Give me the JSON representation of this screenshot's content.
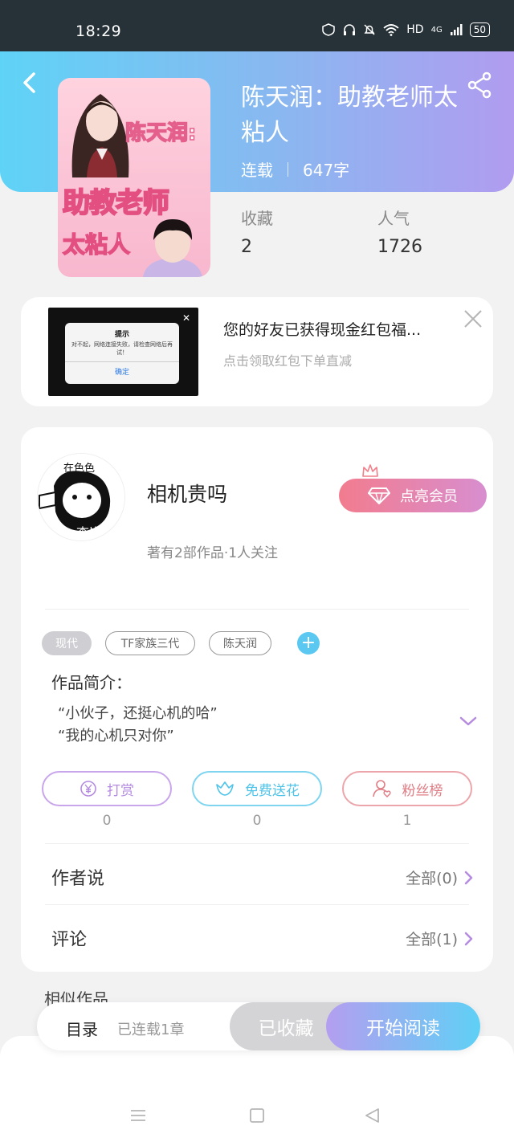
{
  "status_bar": {
    "time": "18:29",
    "network": "HD",
    "signal": "4G",
    "battery": "50"
  },
  "book": {
    "cover_text_1": "陈天润:",
    "cover_text_2": "助教老师",
    "cover_text_3": "太粘人",
    "title": "陈天润：助教老师太粘人",
    "status": "连载",
    "word_count": "647字",
    "stats": [
      {
        "label": "收藏",
        "value": "2"
      },
      {
        "label": "人气",
        "value": "1726"
      }
    ]
  },
  "ad": {
    "dialog_title": "提示",
    "dialog_message": "对不起，网络连接失败，请检查网络后再试！",
    "dialog_ok": "确定",
    "title": "您的好友已获得现金红包福...",
    "subtitle": "点击领取红包下单直减"
  },
  "author": {
    "avatar_text_top": "在色色",
    "avatar_text_bottom": "查岗",
    "name": "相机贵吗",
    "info": "著有2部作品·1人关注",
    "vip_label": "点亮会员"
  },
  "tags": [
    "现代",
    "TF家族三代",
    "陈天润"
  ],
  "intro": {
    "label": "作品简介：",
    "lines": [
      "“小伙子，还挺心机的哈”",
      "“我的心机只对你”"
    ]
  },
  "actions": [
    {
      "label": "打赏",
      "count": "0",
      "icon": "yen-coin-icon",
      "color": "#b58be0"
    },
    {
      "label": "免费送花",
      "count": "0",
      "icon": "flower-icon",
      "color": "#4fc3e8"
    },
    {
      "label": "粉丝榜",
      "count": "1",
      "icon": "fan-user-icon",
      "color": "#e07c84"
    }
  ],
  "author_says": {
    "label": "作者说",
    "link": "全部(0)"
  },
  "comments": {
    "label": "评论",
    "link": "全部(1)"
  },
  "similar": {
    "label": "相似作品"
  },
  "bottom_bar": {
    "toc_label": "目录",
    "toc_sub": "已连载1章",
    "collected_label": "已收藏",
    "read_label": "开始阅读"
  },
  "colors": {
    "header_gradient_start": "#5fd3f6",
    "header_gradient_end": "#b19cf0",
    "accent_purple": "#b58be0",
    "accent_blue": "#4fc3e8",
    "accent_red": "#e07c84"
  }
}
